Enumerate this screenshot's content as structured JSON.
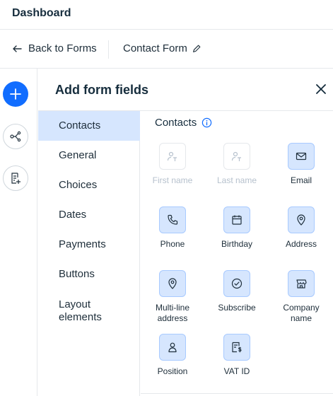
{
  "header": {
    "title": "Dashboard"
  },
  "nav": {
    "back_label": "Back to Forms",
    "form_name": "Contact Form"
  },
  "panel": {
    "title": "Add form fields"
  },
  "categories": [
    {
      "label": "Contacts",
      "selected": true
    },
    {
      "label": "General"
    },
    {
      "label": "Choices"
    },
    {
      "label": "Dates"
    },
    {
      "label": "Payments"
    },
    {
      "label": "Buttons"
    },
    {
      "label": "Layout elements"
    }
  ],
  "section": {
    "title": "Contacts"
  },
  "fields": [
    {
      "label": "First name",
      "icon": "first-name-icon",
      "disabled": true
    },
    {
      "label": "Last name",
      "icon": "last-name-icon",
      "disabled": true
    },
    {
      "label": "Email",
      "icon": "email-icon"
    },
    {
      "label": "Phone",
      "icon": "phone-icon"
    },
    {
      "label": "Birthday",
      "icon": "calendar-icon"
    },
    {
      "label": "Address",
      "icon": "location-pin-icon"
    },
    {
      "label": "Multi-line address",
      "icon": "location-pin-icon"
    },
    {
      "label": "Subscribe",
      "icon": "check-circle-icon"
    },
    {
      "label": "Company name",
      "icon": "store-icon"
    },
    {
      "label": "Position",
      "icon": "person-icon"
    },
    {
      "label": "VAT ID",
      "icon": "invoice-dollar-icon"
    }
  ],
  "colors": {
    "accent": "#116dff",
    "selected_bg": "#d6e6fe",
    "icon_border": "#a8caff"
  }
}
